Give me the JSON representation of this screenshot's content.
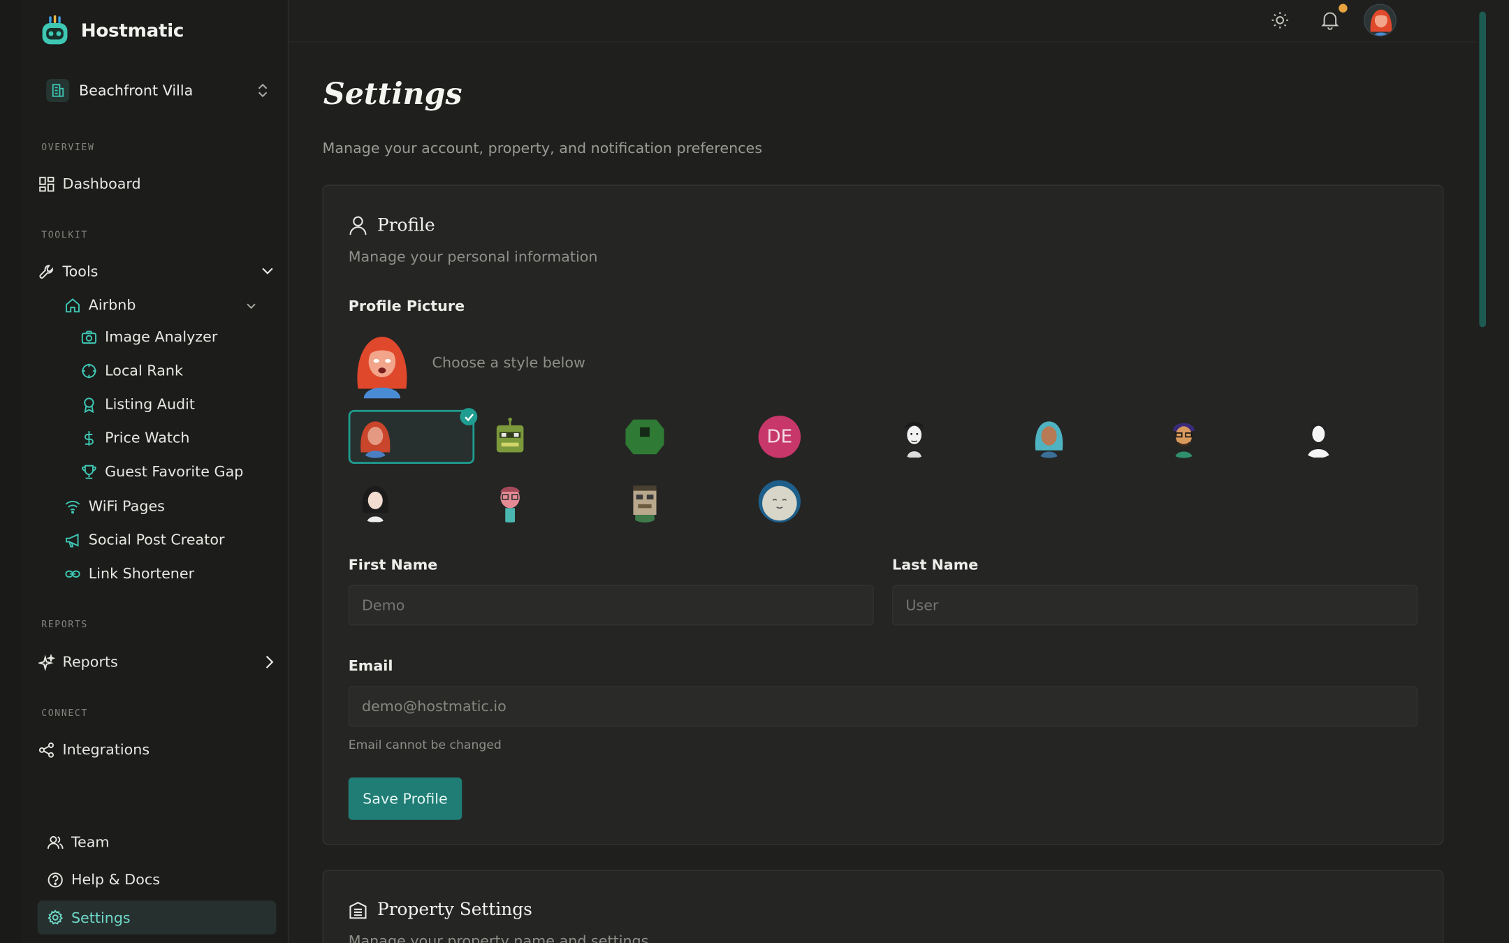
{
  "brand": {
    "name": "Hostmatic"
  },
  "property_selector": {
    "name": "Beachfront Villa"
  },
  "sidebar": {
    "sections": {
      "overview": "OVERVIEW",
      "toolkit": "TOOLKIT",
      "reports": "REPORTS",
      "connect": "CONNECT"
    },
    "dashboard": "Dashboard",
    "tools": "Tools",
    "airbnb": "Airbnb",
    "airbnb_items": [
      "Image Analyzer",
      "Local Rank",
      "Listing Audit",
      "Price Watch",
      "Guest Favorite Gap"
    ],
    "tool_items": [
      "WiFi Pages",
      "Social Post Creator",
      "Link Shortener"
    ],
    "reports": "Reports",
    "integrations": "Integrations",
    "bottom": {
      "team": "Team",
      "help": "Help & Docs",
      "settings": "Settings"
    }
  },
  "colors": {
    "accent": "#1f9d91",
    "accent_text": "#6fd8c8",
    "notification": "#e7a33e",
    "background": "#1f1f1e"
  },
  "page": {
    "title": "Settings",
    "subtitle": "Manage your account, property, and notification preferences"
  },
  "profile_card": {
    "title": "Profile",
    "subtitle": "Manage your personal information",
    "picture_label": "Profile Picture",
    "choose_text": "Choose a style below",
    "initials_avatar": "DE",
    "first_name_label": "First Name",
    "first_name_placeholder": "Demo",
    "last_name_label": "Last Name",
    "last_name_placeholder": "User",
    "email_label": "Email",
    "email_value": "demo@hostmatic.io",
    "email_hint": "Email cannot be changed",
    "save_label": "Save Profile"
  },
  "property_card": {
    "title": "Property Settings",
    "subtitle": "Manage your property name and settings"
  }
}
